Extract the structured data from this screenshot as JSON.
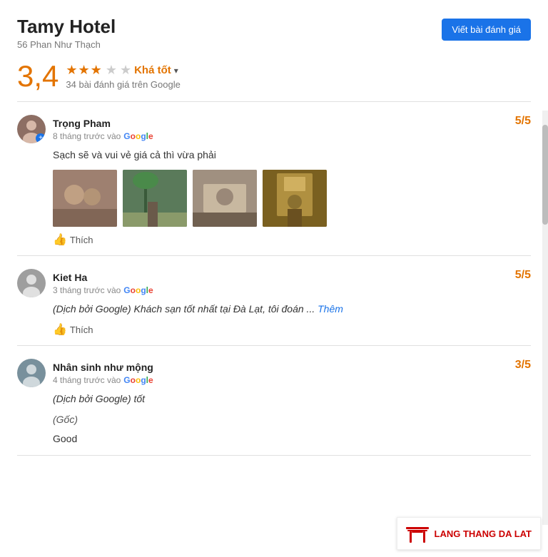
{
  "hotel": {
    "name": "Tamy Hotel",
    "address": "56 Phan Như Thạch",
    "rating": "3,4",
    "stars_full": 3,
    "stars_half": 1,
    "rating_label": "Khá tốt",
    "review_count": "34 bài đánh giá trên Google",
    "write_review_btn": "Viết bài đánh giá"
  },
  "reviews": [
    {
      "name": "Trọng Pham",
      "time": "8 tháng trước vào",
      "score": "5/5",
      "text": "Sạch sẽ và vui vẻ  giá cả thì vừa phải",
      "has_images": true,
      "like_label": "Thích",
      "avatar_bg": "#8d6e63"
    },
    {
      "name": "Kiet Ha",
      "time": "3 tháng trước vào",
      "score": "5/5",
      "text": "(Dịch bởi Google) Khách sạn tốt nhất tại Đà Lạt, tôi đoán ...",
      "more_label": "Thêm",
      "like_label": "Thích",
      "avatar_bg": "#9e9e9e"
    },
    {
      "name": "Nhân sinh như mộng",
      "time": "4 tháng trước vào",
      "score": "3/5",
      "text_translated": "(Dịch bởi Google) tốt",
      "text_original_label": "(Gốc)",
      "text_original": "Good",
      "like_label": "Thích",
      "avatar_bg": "#78909c"
    }
  ],
  "branding": {
    "icon_alt": "torii-gate",
    "text": "LANG THANG DA LAT"
  }
}
